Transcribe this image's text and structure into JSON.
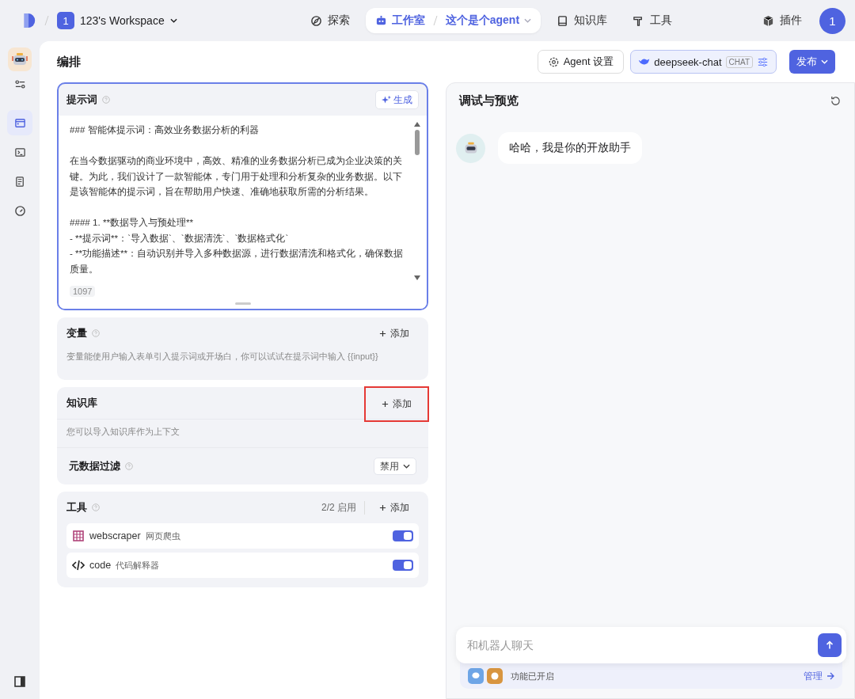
{
  "topbar": {
    "workspace_badge": "1",
    "workspace": "123's Workspace",
    "nav": [
      {
        "kind": "explore",
        "label": "探索",
        "selected": false
      },
      {
        "kind": "studio",
        "label": "工作室",
        "crumb": "这个是个agent",
        "selected": true
      },
      {
        "kind": "knowledge",
        "label": "知识库",
        "selected": false
      },
      {
        "kind": "tools",
        "label": "工具",
        "selected": false
      }
    ],
    "plugins": "插件",
    "avatar": "1"
  },
  "sidebar": {
    "items": [
      {
        "kind": "sliders",
        "selected": false
      },
      {
        "kind": "layout",
        "selected": true
      },
      {
        "kind": "terminal",
        "selected": false
      },
      {
        "kind": "document",
        "selected": false
      },
      {
        "kind": "gauge",
        "selected": false
      }
    ]
  },
  "editor": {
    "title": "编排",
    "agent_settings": "Agent 设置",
    "model": "deepseek-chat",
    "model_tag": "CHAT",
    "publish": "发布",
    "prompt": {
      "title": "提示词",
      "generate": "生成",
      "paragraphs": [
        [
          "### 智能体提示词：高效业务数据分析的利器"
        ],
        [
          "在当今数据驱动的商业环境中，高效、精准的业务数据分析已成为企业决策的关键。为此，我们设计了一款智能体，专门用于处理和分析复杂的业务数据。以下是该智能体的提示词，旨在帮助用户快速、准确地获取所需的分析结果。"
        ],
        [
          "#### 1. **数据导入与预处理**",
          "- **提示词**：`导入数据`、`数据清洗`、`数据格式化`",
          "- **功能描述**：自动识别并导入多种数据源，进行数据清洗和格式化，确保数据质量。"
        ]
      ],
      "count": "1097"
    },
    "variables": {
      "title": "变量",
      "add": "添加",
      "hint": "变量能使用户输入表单引入提示词或开场白，你可以试试在提示词中输入 {{input}}"
    },
    "knowledge": {
      "title": "知识库",
      "add": "添加",
      "highlighted": true,
      "hint": "您可以导入知识库作为上下文",
      "filter_label": "元数据过滤",
      "filter_value": "禁用"
    },
    "tools": {
      "title": "工具",
      "count": "2/2 启用",
      "add": "添加",
      "items": [
        {
          "kind": "web",
          "name": "webscraper",
          "desc": "网页爬虫",
          "on": true
        },
        {
          "kind": "code",
          "name": "code",
          "desc": "代码解释器",
          "on": true
        }
      ]
    }
  },
  "preview": {
    "title": "调试与预览",
    "messages": [
      {
        "text": "哈哈，我是你的开放助手"
      }
    ],
    "input_placeholder": "和机器人聊天",
    "features": "功能已开启",
    "manage": "管理"
  }
}
